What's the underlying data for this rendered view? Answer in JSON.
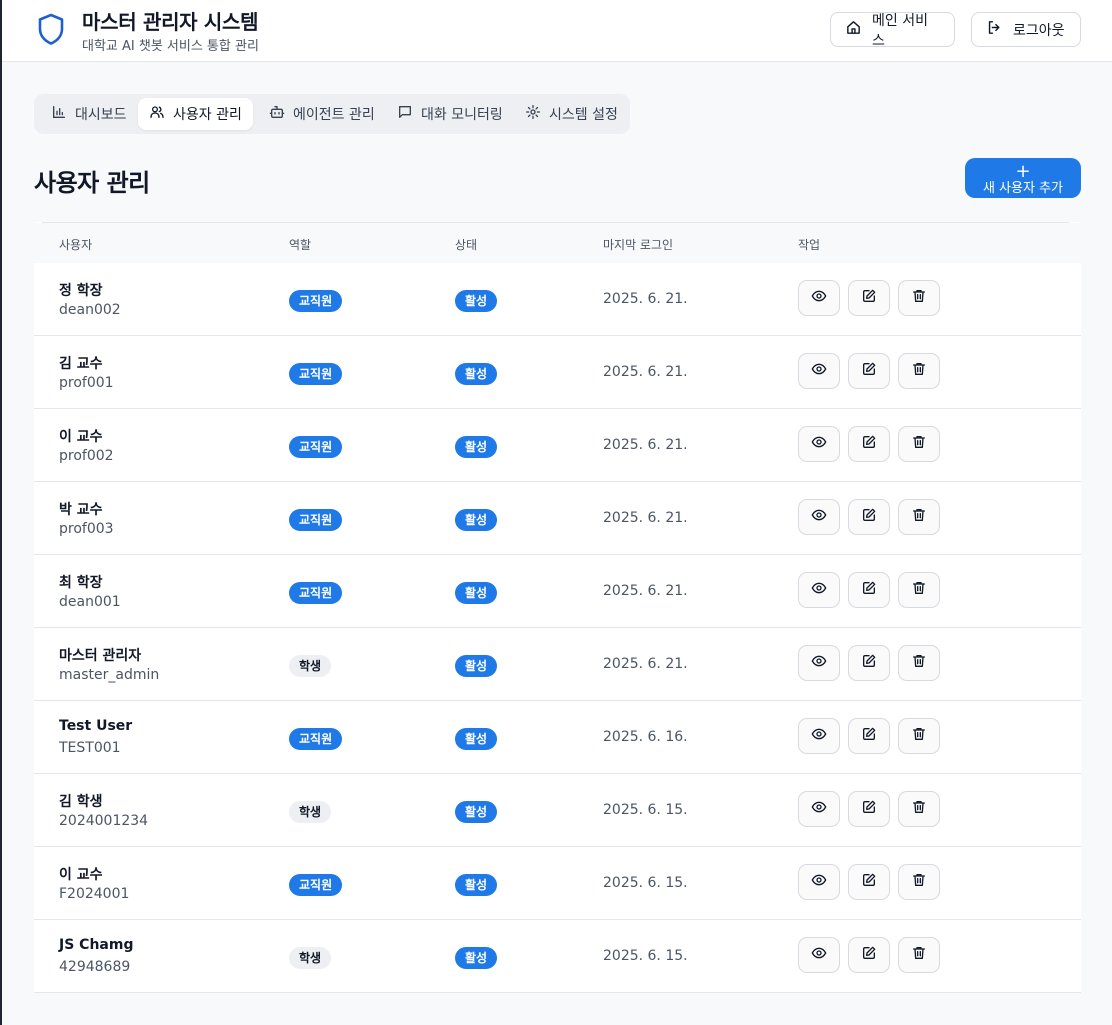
{
  "header": {
    "title": "마스터 관리자 시스템",
    "subtitle": "대학교 AI 챗봇 서비스 통합 관리",
    "main_service_label": "메인 서비스",
    "logout_label": "로그아웃"
  },
  "tabs": [
    {
      "label": "대시보드",
      "icon": "chart-icon",
      "active": false
    },
    {
      "label": "사용자 관리",
      "icon": "users-icon",
      "active": true
    },
    {
      "label": "에이전트 관리",
      "icon": "bot-icon",
      "active": false
    },
    {
      "label": "대화 모니터링",
      "icon": "message-icon",
      "active": false
    },
    {
      "label": "시스템 설정",
      "icon": "gear-icon",
      "active": false
    }
  ],
  "page": {
    "title": "사용자 관리",
    "add_button_label": "새 사용자 추가"
  },
  "table": {
    "columns": [
      "사용자",
      "역할",
      "상태",
      "마지막 로그인",
      "작업"
    ],
    "rows": [
      {
        "name": "정 학장",
        "id": "dean002",
        "role": "교직원",
        "status": "활성",
        "last_login": "2025. 6. 21."
      },
      {
        "name": "김 교수",
        "id": "prof001",
        "role": "교직원",
        "status": "활성",
        "last_login": "2025. 6. 21."
      },
      {
        "name": "이 교수",
        "id": "prof002",
        "role": "교직원",
        "status": "활성",
        "last_login": "2025. 6. 21."
      },
      {
        "name": "박 교수",
        "id": "prof003",
        "role": "교직원",
        "status": "활성",
        "last_login": "2025. 6. 21."
      },
      {
        "name": "최 학장",
        "id": "dean001",
        "role": "교직원",
        "status": "활성",
        "last_login": "2025. 6. 21."
      },
      {
        "name": "마스터 관리자",
        "id": "master_admin",
        "role": "학생",
        "status": "활성",
        "last_login": "2025. 6. 21."
      },
      {
        "name": "Test User",
        "id": "TEST001",
        "role": "교직원",
        "status": "활성",
        "last_login": "2025. 6. 16."
      },
      {
        "name": "김 학생",
        "id": "2024001234",
        "role": "학생",
        "status": "활성",
        "last_login": "2025. 6. 15."
      },
      {
        "name": "이 교수",
        "id": "F2024001",
        "role": "교직원",
        "status": "활성",
        "last_login": "2025. 6. 15."
      },
      {
        "name": "JS Chamg",
        "id": "42948689",
        "role": "학생",
        "status": "활성",
        "last_login": "2025. 6. 15."
      }
    ]
  },
  "colors": {
    "accent": "#1f7ae8",
    "background": "#f8f9fb",
    "border": "#e5e7eb"
  }
}
